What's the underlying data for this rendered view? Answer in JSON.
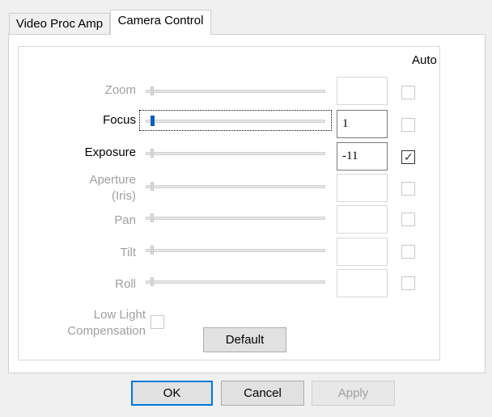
{
  "tabs": [
    {
      "label": "Video Proc Amp",
      "active": false
    },
    {
      "label": "Camera Control",
      "active": true
    }
  ],
  "auto_header": "Auto",
  "controls": [
    {
      "label": "Zoom",
      "value": "",
      "enabled": false,
      "auto": false
    },
    {
      "label": "Focus",
      "value": "1",
      "enabled": true,
      "auto": false
    },
    {
      "label": "Exposure",
      "value": "-11",
      "enabled": true,
      "auto": true
    },
    {
      "label": "Aperture (Iris)",
      "label_line1": "Aperture",
      "label_line2": "(Iris)",
      "value": "",
      "enabled": false,
      "auto": false
    },
    {
      "label": "Pan",
      "value": "",
      "enabled": false,
      "auto": false
    },
    {
      "label": "Tilt",
      "value": "",
      "enabled": false,
      "auto": false
    },
    {
      "label": "Roll",
      "value": "",
      "enabled": false,
      "auto": false
    }
  ],
  "low_light": {
    "line1": "Low Light",
    "line2": "Compensation",
    "checked": false
  },
  "buttons": {
    "default": "Default",
    "ok": "OK",
    "cancel": "Cancel",
    "apply": "Apply"
  },
  "colors": {
    "accent": "#0078d7",
    "slider_active": "#0a5fb8",
    "disabled_text": "#a0a0a0"
  }
}
